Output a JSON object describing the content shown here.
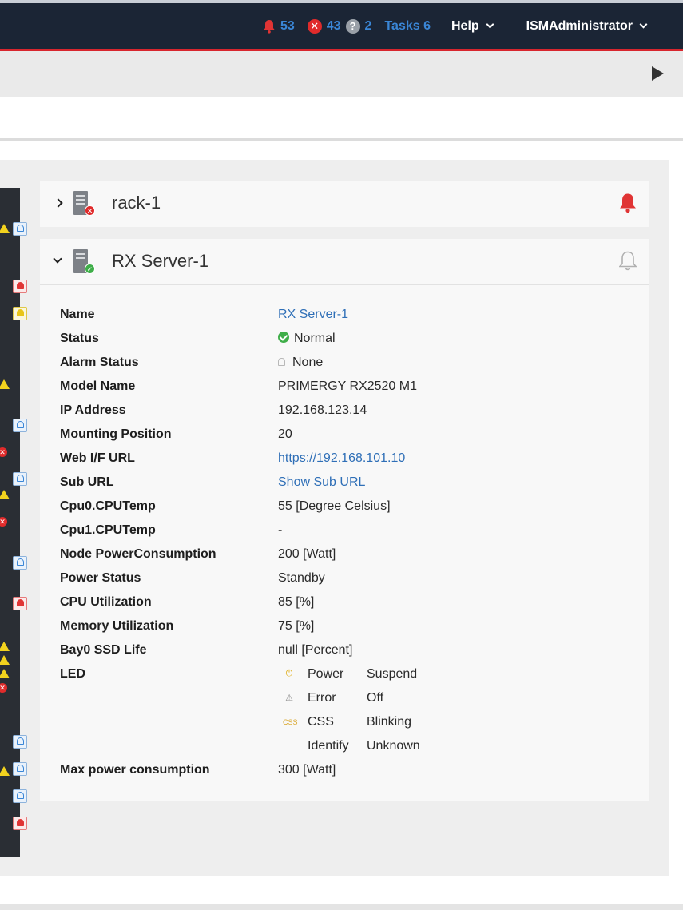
{
  "topbar": {
    "alarm_count": "53",
    "error_count": "43",
    "unknown_count": "2",
    "tasks_label": "Tasks 6",
    "help_label": "Help",
    "user_label": "ISMAdministrator",
    "error_icon_glyph": "✕",
    "unknown_icon_glyph": "?"
  },
  "rack": {
    "title": "rack-1",
    "alarm_color": "#e03434",
    "status_icon_glyph": "✕"
  },
  "server": {
    "title": "RX Server-1",
    "status_icon_glyph": "✓",
    "properties": [
      {
        "label": "Name",
        "value": "RX Server-1",
        "link": true
      },
      {
        "label": "Status",
        "value": "Normal",
        "icon": "ok-icon"
      },
      {
        "label": "Alarm Status",
        "value": "None",
        "icon": "bell-icon"
      },
      {
        "label": "Model Name",
        "value": "PRIMERGY RX2520 M1"
      },
      {
        "label": "IP Address",
        "value": "192.168.123.14"
      },
      {
        "label": "Mounting Position",
        "value": "20"
      },
      {
        "label": "Web I/F URL",
        "value": "https://192.168.101.10",
        "link": true
      },
      {
        "label": "Sub URL",
        "value": "Show Sub URL",
        "link": true
      },
      {
        "label": "Cpu0.CPUTemp",
        "value": "55 [Degree Celsius]"
      },
      {
        "label": "Cpu1.CPUTemp",
        "value": "-"
      },
      {
        "label": "Node PowerConsumption",
        "value": "200 [Watt]"
      },
      {
        "label": "Power Status",
        "value": "Standby"
      },
      {
        "label": "CPU Utilization",
        "value": "85 [%]"
      },
      {
        "label": "Memory Utilization",
        "value": "75 [%]"
      },
      {
        "label": "Bay0 SSD Life",
        "value": "null [Percent]"
      },
      {
        "label": "LED",
        "value": ""
      }
    ],
    "led": [
      {
        "icon": "power-icon",
        "glyph": "⏻",
        "name": "Power",
        "state": "Suspend"
      },
      {
        "icon": "error-triangle-icon",
        "glyph": "⚠",
        "name": "Error",
        "state": "Off"
      },
      {
        "icon": "css-icon",
        "glyph": "CSS",
        "name": "CSS",
        "state": "Blinking"
      },
      {
        "icon": "",
        "glyph": "",
        "name": "Identify",
        "state": "Unknown"
      }
    ],
    "max_power_label": "Max power consumption",
    "max_power_value": "300 [Watt]"
  },
  "colors": {
    "topbar_bg": "#1b2535",
    "accent_red": "#d8262e",
    "link_blue": "#2f6fb7",
    "ok_green": "#3fae49",
    "warn_yellow": "#f2d21e"
  }
}
